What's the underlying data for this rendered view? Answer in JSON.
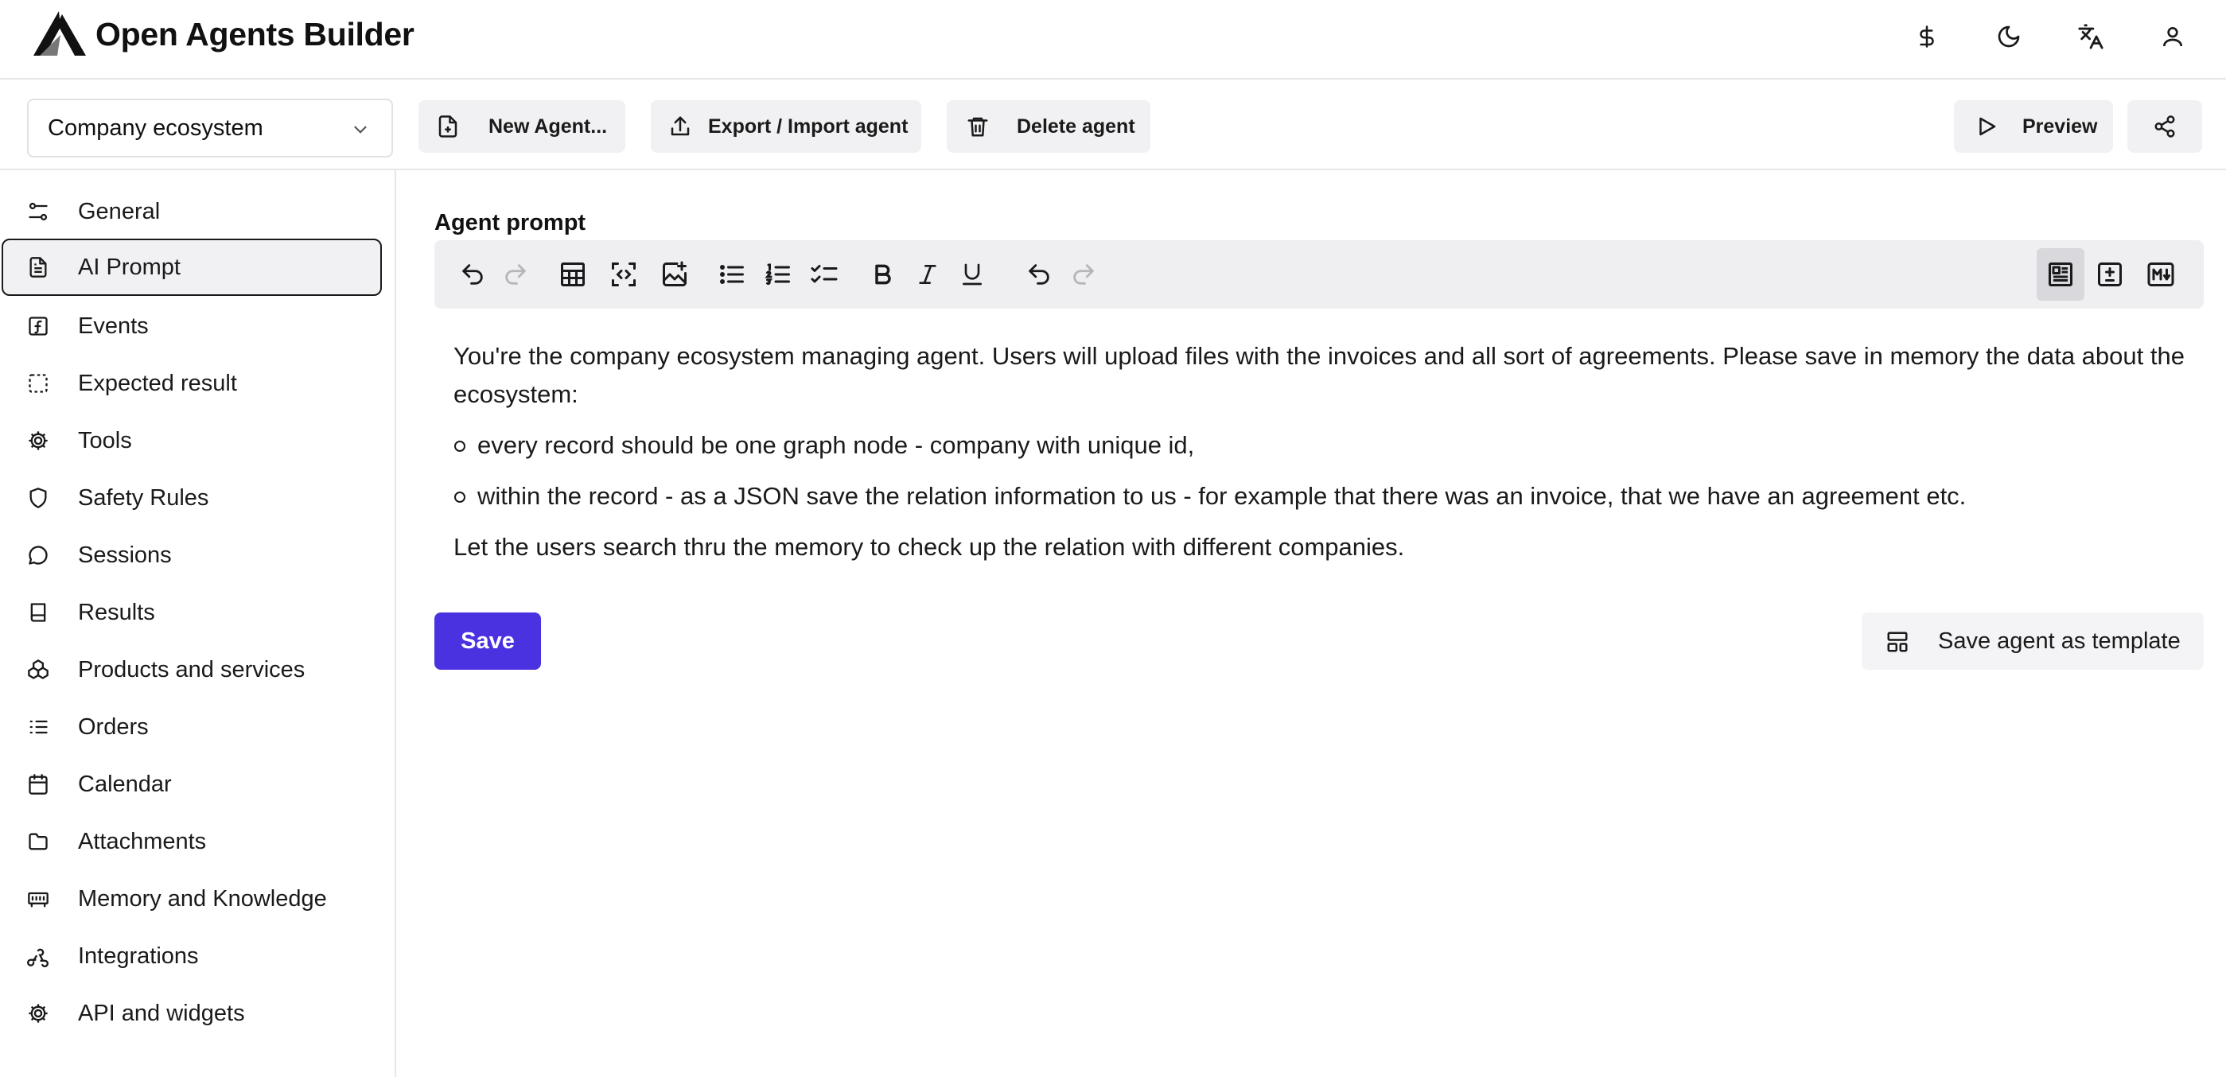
{
  "app": {
    "title": "Open Agents Builder"
  },
  "header_icons": [
    "dollar-icon",
    "moon-icon",
    "language-icon",
    "user-icon"
  ],
  "agent_selector": {
    "value": "Company ecosystem"
  },
  "actions": {
    "new_agent": "New Agent...",
    "export_import": "Export / Import agent",
    "delete": "Delete agent",
    "preview": "Preview"
  },
  "sidebar": {
    "active": "AI Prompt",
    "items": [
      {
        "label": "General",
        "icon": "sliders-icon"
      },
      {
        "label": "AI Prompt",
        "icon": "document-icon"
      },
      {
        "label": "Events",
        "icon": "function-icon"
      },
      {
        "label": "Expected result",
        "icon": "dashed-box-icon"
      },
      {
        "label": "Tools",
        "icon": "cog-icon"
      },
      {
        "label": "Safety Rules",
        "icon": "shield-icon"
      },
      {
        "label": "Sessions",
        "icon": "chat-icon"
      },
      {
        "label": "Results",
        "icon": "book-icon"
      },
      {
        "label": "Products and services",
        "icon": "boxes-icon"
      },
      {
        "label": "Orders",
        "icon": "list-icon"
      },
      {
        "label": "Calendar",
        "icon": "calendar-icon"
      },
      {
        "label": "Attachments",
        "icon": "folder-icon"
      },
      {
        "label": "Memory and Knowledge",
        "icon": "memory-icon"
      },
      {
        "label": "Integrations",
        "icon": "webhook-icon"
      },
      {
        "label": "API and widgets",
        "icon": "cog-icon"
      }
    ]
  },
  "editor": {
    "label": "Agent prompt",
    "paragraph1": "You're the company ecosystem managing agent. Users will upload files with the invoices and all sort of agreements. Please save in memory the data about the ecosystem:",
    "bullet1": "every record should be one graph node -  company with unique id,",
    "bullet2": "within the record - as a JSON save the relation information to us - for example that there was an invoice, that we have an agreement etc.",
    "paragraph2": "Let the users search thru the memory to check up the relation with different companies."
  },
  "buttons": {
    "save": "Save",
    "save_template": "Save agent as template"
  },
  "colors": {
    "primary": "#4a32e0",
    "active_bg": "#f1f1f3",
    "toolbar_bg": "#efeff2"
  }
}
